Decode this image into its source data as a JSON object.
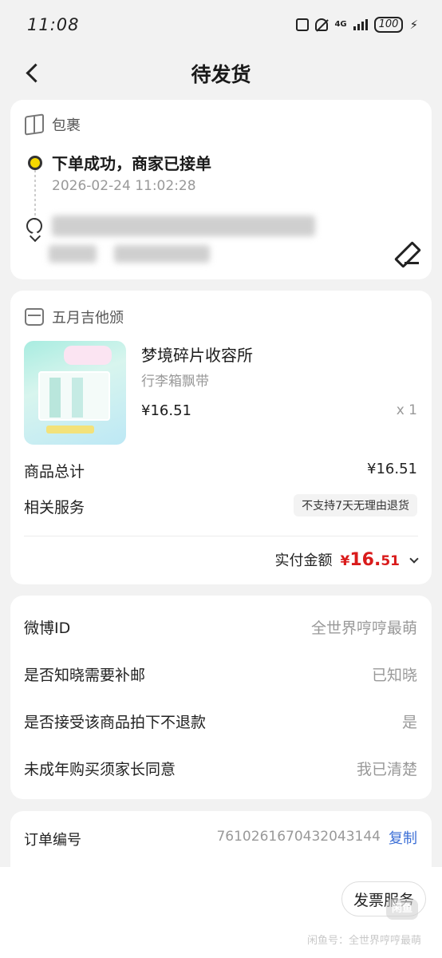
{
  "status_bar": {
    "time": "11:08",
    "network": "4G",
    "battery": "100"
  },
  "header": {
    "title": "待发货"
  },
  "package": {
    "section_label": "包裹",
    "status_title": "下单成功，商家已接单",
    "status_time": "2026-02-24 11:02:28"
  },
  "order": {
    "shop_name": "五月吉他颁",
    "product": {
      "name": "梦境碎片收容所",
      "spec": "行李箱飘带",
      "price": "¥16.51",
      "quantity": "x 1"
    },
    "total_label": "商品总计",
    "total_value": "¥16.51",
    "service_label": "相关服务",
    "service_value": "不支持7天无理由退货",
    "paid_label": "实付金额",
    "paid_symbol": "¥",
    "paid_int": "16.",
    "paid_dec": "51"
  },
  "info_rows": [
    {
      "label": "微博ID",
      "value": "全世界哼哼最萌"
    },
    {
      "label": "是否知晓需要补邮",
      "value": "已知晓"
    },
    {
      "label": "是否接受该商品拍下不退款",
      "value": "是"
    },
    {
      "label": "未成年购买须家长同意",
      "value": "我已清楚"
    }
  ],
  "order_no": {
    "label": "订单编号",
    "value": "7610261670432043144",
    "copy_label": "复制"
  },
  "bottom": {
    "invoice_label": "发票服务",
    "watermark": "闲鱼号：全世界哼哼最萌",
    "logo_text": "闲鱼"
  },
  "colors": {
    "accent_yellow": "#f5d800",
    "price_red": "#d91b1b",
    "link_blue": "#3c6fd6",
    "background": "#f2f2f2"
  },
  "icons": [
    "back-icon",
    "box-icon",
    "location-icon",
    "edit-icon",
    "store-icon",
    "chevron-down-icon"
  ]
}
